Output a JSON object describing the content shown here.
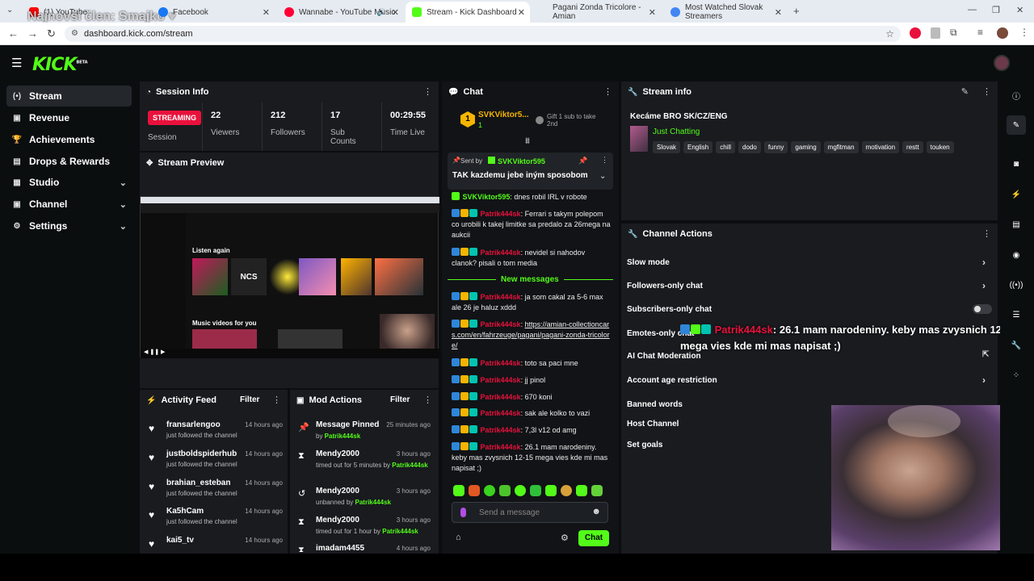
{
  "browser": {
    "tabs": [
      {
        "label": "(1) YouTube",
        "overlay": "Najnovší člen: Smajko ♥",
        "color": "#ff0000"
      },
      {
        "label": "Facebook",
        "color": "#1877f2"
      },
      {
        "label": "Wannabe - YouTube Music",
        "color": "#ff0033"
      },
      {
        "label": "Stream - Kick Dashboard",
        "color": "#53fc18"
      },
      {
        "label": "Pagani Zonda Tricolore - Amian",
        "color": "#888888"
      },
      {
        "label": "Most Watched Slovak Streamers",
        "color": "#4285f4"
      }
    ],
    "url": "dashboard.kick.com/stream"
  },
  "logo": "KICK",
  "logo_sup": "BETA",
  "sidebar": {
    "items": [
      {
        "label": "Stream",
        "icon": "stream-icon"
      },
      {
        "label": "Revenue",
        "icon": "revenue-icon"
      },
      {
        "label": "Achievements",
        "icon": "trophy-icon"
      },
      {
        "label": "Drops & Rewards",
        "icon": "drops-icon"
      },
      {
        "label": "Studio",
        "icon": "studio-icon"
      },
      {
        "label": "Channel",
        "icon": "channel-icon"
      },
      {
        "label": "Settings",
        "icon": "gear-icon"
      }
    ]
  },
  "session": {
    "title": "Session Info",
    "status": "STREAMING",
    "status_label": "Session",
    "viewers": "22",
    "viewers_label": "Viewers",
    "followers": "212",
    "followers_label": "Followers",
    "subs": "17",
    "subs_label": "Sub Counts",
    "time": "00:29:55",
    "time_label": "Time Live"
  },
  "preview": {
    "title": "Stream Preview",
    "listen_again": "Listen again",
    "music_videos": "Music videos for you",
    "ncs": "NCS"
  },
  "activity": {
    "title": "Activity Feed",
    "filter": "Filter",
    "items": [
      {
        "who": "fransarlengoo",
        "what": "just followed the channel",
        "when": "14 hours ago"
      },
      {
        "who": "justboldspiderhub",
        "what": "just followed the channel",
        "when": "14 hours ago"
      },
      {
        "who": "brahian_esteban",
        "what": "just followed the channel",
        "when": "14 hours ago"
      },
      {
        "who": "Ka5hCam",
        "what": "just followed the channel",
        "when": "14 hours ago"
      },
      {
        "who": "kai5_tv",
        "what": "",
        "when": "14 hours ago"
      }
    ]
  },
  "mod": {
    "title": "Mod Actions",
    "filter": "Filter",
    "items": [
      {
        "who": "Message Pinned",
        "what": "by ",
        "by": "Patrik444sk",
        "when": "25 minutes ago"
      },
      {
        "who": "Mendy2000",
        "what": "timed out for 5 minutes by ",
        "by": "Patrik444sk",
        "when": "3 hours ago"
      },
      {
        "who": "Mendy2000",
        "what": "unbanned by ",
        "by": "Patrik444sk",
        "when": "3 hours ago"
      },
      {
        "who": "Mendy2000",
        "what": "timed out for 1 hour by ",
        "by": "Patrik444sk",
        "when": "3 hours ago"
      },
      {
        "who": "imadam4455",
        "what": "",
        "by": "",
        "when": "4 hours ago"
      }
    ]
  },
  "chat": {
    "title": "Chat",
    "top_user": "SVKViktor5...",
    "top_user_count": "1",
    "gift_text": "Gift 1 sub to take 2nd",
    "pinned_by_label": "Sent by",
    "pinned_user": "SVKViktor595",
    "pinned_message": "TAK kazdemu jebe iným sposobom",
    "new_messages": "New messages",
    "input_placeholder": "Send a message",
    "send": "Chat",
    "messages": [
      {
        "user": "SVKViktor595",
        "text": ": dnes robil IRL v robote",
        "green": true
      },
      {
        "user": "Patrik444sk",
        "text": ": Ferrari s takym polepom co urobili k takej limitke sa predalo za 26mega na aukcii"
      },
      {
        "user": "Patrik444sk",
        "text": ": nevidel si nahodov clanok? pisali o tom media"
      },
      {
        "user": "Patrik444sk",
        "text": ": ja som cakal za 5-6 max ale 26 je haluz xddd"
      },
      {
        "user": "Patrik444sk",
        "text": ": ",
        "link": "https://amian-collectioncars.com/en/fahrzeuge/pagani/pagani-zonda-tricolore/"
      },
      {
        "user": "Patrik444sk",
        "text": ": toto sa paci mne"
      },
      {
        "user": "Patrik444sk",
        "text": ": jj pinol"
      },
      {
        "user": "Patrik444sk",
        "text": ": 670 koni"
      },
      {
        "user": "Patrik444sk",
        "text": ": sak ale kolko to vazi"
      },
      {
        "user": "Patrik444sk",
        "text": ": 7,3l v12 od amg"
      },
      {
        "user": "Patrik444sk",
        "text": ": 26.1 mam narodeniny. keby mas zvysnich 12-15 mega vies kde mi mas napisat ;)"
      }
    ]
  },
  "stream_info": {
    "title": "Stream info",
    "stream_title": "Kecáme BRO SK/CZ/ENG",
    "category": "Just Chatting",
    "tags": [
      "Slovak",
      "English",
      "chill",
      "dodo",
      "funny",
      "gaming",
      "mgfitman",
      "motivation",
      "restt",
      "touken"
    ]
  },
  "channel_actions": {
    "title": "Channel Actions",
    "items": [
      "Slow mode",
      "Followers-only chat",
      "Subscribers-only chat",
      "Emotes-only chat",
      "AI Chat Moderation",
      "Account age restriction",
      "Banned words",
      "Host Channel",
      "Set goals"
    ]
  },
  "overlay_alert": {
    "user": "Patrik444sk",
    "text": ": 26.1 mam narodeniny. keby mas zvysnich 12-15 mega vies kde mi mas napisat ;)"
  },
  "colors": {
    "accent": "#53fc18",
    "panel": "#191b1f",
    "bg": "#0b0e0f",
    "streaming": "#e9113c"
  }
}
